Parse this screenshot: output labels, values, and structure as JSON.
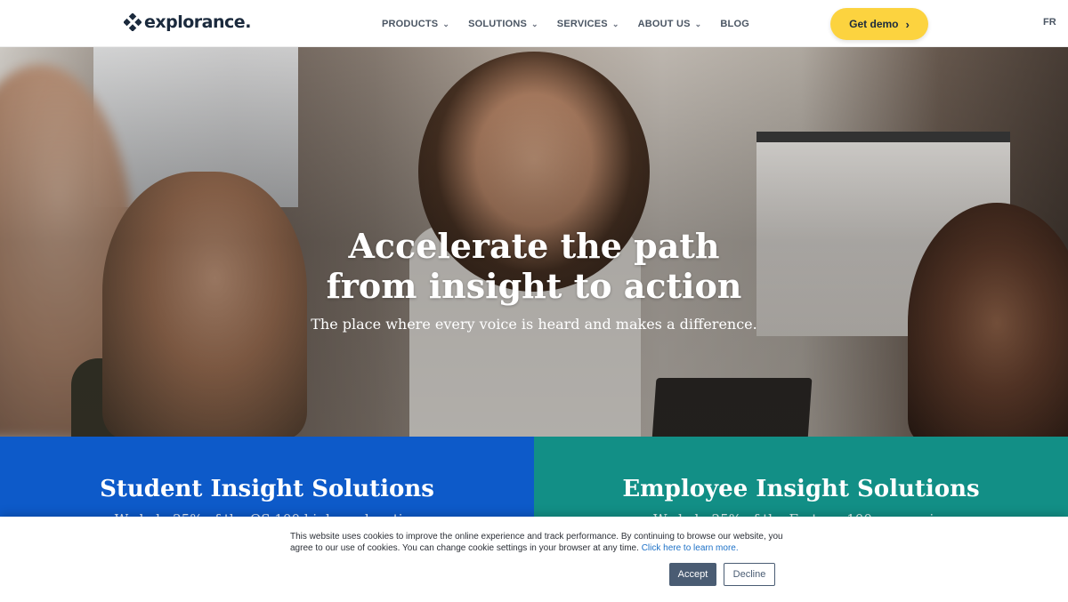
{
  "header": {
    "logo_text": "explorance",
    "logo_dot": ".",
    "nav": [
      {
        "label": "PRODUCTS",
        "has_dropdown": true
      },
      {
        "label": "SOLUTIONS",
        "has_dropdown": true
      },
      {
        "label": "SERVICES",
        "has_dropdown": true
      },
      {
        "label": "ABOUT US",
        "has_dropdown": true
      },
      {
        "label": "BLOG",
        "has_dropdown": false
      }
    ],
    "demo_button": "Get demo",
    "language": "FR"
  },
  "hero": {
    "title_line1": "Accelerate the path",
    "title_line2": "from insight to action",
    "subtitle": "The place where every voice is heard and makes a difference."
  },
  "panels": {
    "student": {
      "title": "Student Insight Solutions",
      "description": "We help 25% of the QS 100 higher education"
    },
    "employee": {
      "title": "Employee Insight Solutions",
      "description": "We help 25% of the Fortune 100 companies"
    }
  },
  "cookie": {
    "text": "This website uses cookies to improve the online experience and track performance. By continuing to browse our website, you agree to our use of cookies. You can change cookie settings in your browser at any time.",
    "link": "Click here to learn more.",
    "accept": "Accept",
    "decline": "Decline"
  },
  "colors": {
    "brand_navy": "#1b2a3d",
    "demo_yellow": "#fcd33f",
    "student_blue": "#0d5ac9",
    "employee_teal": "#128f86",
    "accept_slate": "#4a5c73"
  }
}
